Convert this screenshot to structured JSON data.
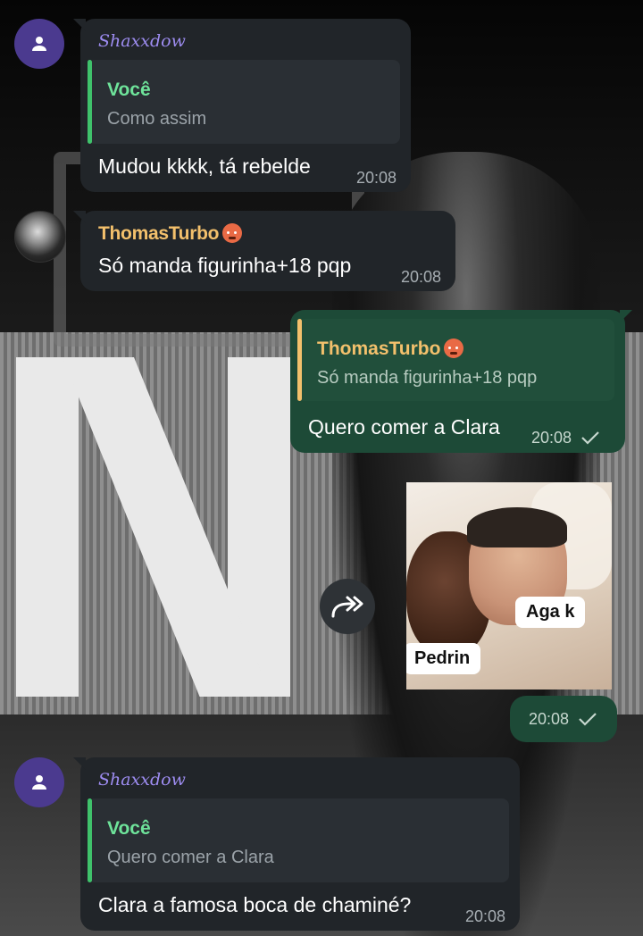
{
  "messages": [
    {
      "sender": "Shaxxdow",
      "reply_to": {
        "name": "Você",
        "text": "Como assim"
      },
      "text": "Mudou kkkk, tá rebelde",
      "time": "20:08"
    },
    {
      "sender": "ThomasTurbo",
      "text": "Só manda figurinha+18 pqp",
      "time": "20:08"
    },
    {
      "reply_to": {
        "name": "ThomasTurbo",
        "text": "Só manda figurinha+18 pqp"
      },
      "text": "Quero comer a Clara",
      "time": "20:08"
    },
    {
      "media_labels": [
        "Aga k",
        "Pedrin"
      ],
      "time": "20:08"
    },
    {
      "sender": "Shaxxdow",
      "reply_to": {
        "name": "Você",
        "text": "Quero comer a Clara"
      },
      "text": "Clara a famosa boca de chaminé?",
      "time": "20:08"
    }
  ],
  "icons": {
    "avatar_default": "person-icon",
    "forward": "forward-icon",
    "read_status": "check-icon",
    "sender_emoji": "hot-face-emoji"
  },
  "colors": {
    "incoming_bubble": "#212529",
    "outgoing_bubble": "#1d4a37",
    "reply_bar_you": "#3fc26b",
    "reply_bar_thomas": "#f3c06c",
    "sender_shaxxdow": "#9d8cf0",
    "sender_thomas": "#f3c06c",
    "avatar_user": "#4b3a8f"
  }
}
